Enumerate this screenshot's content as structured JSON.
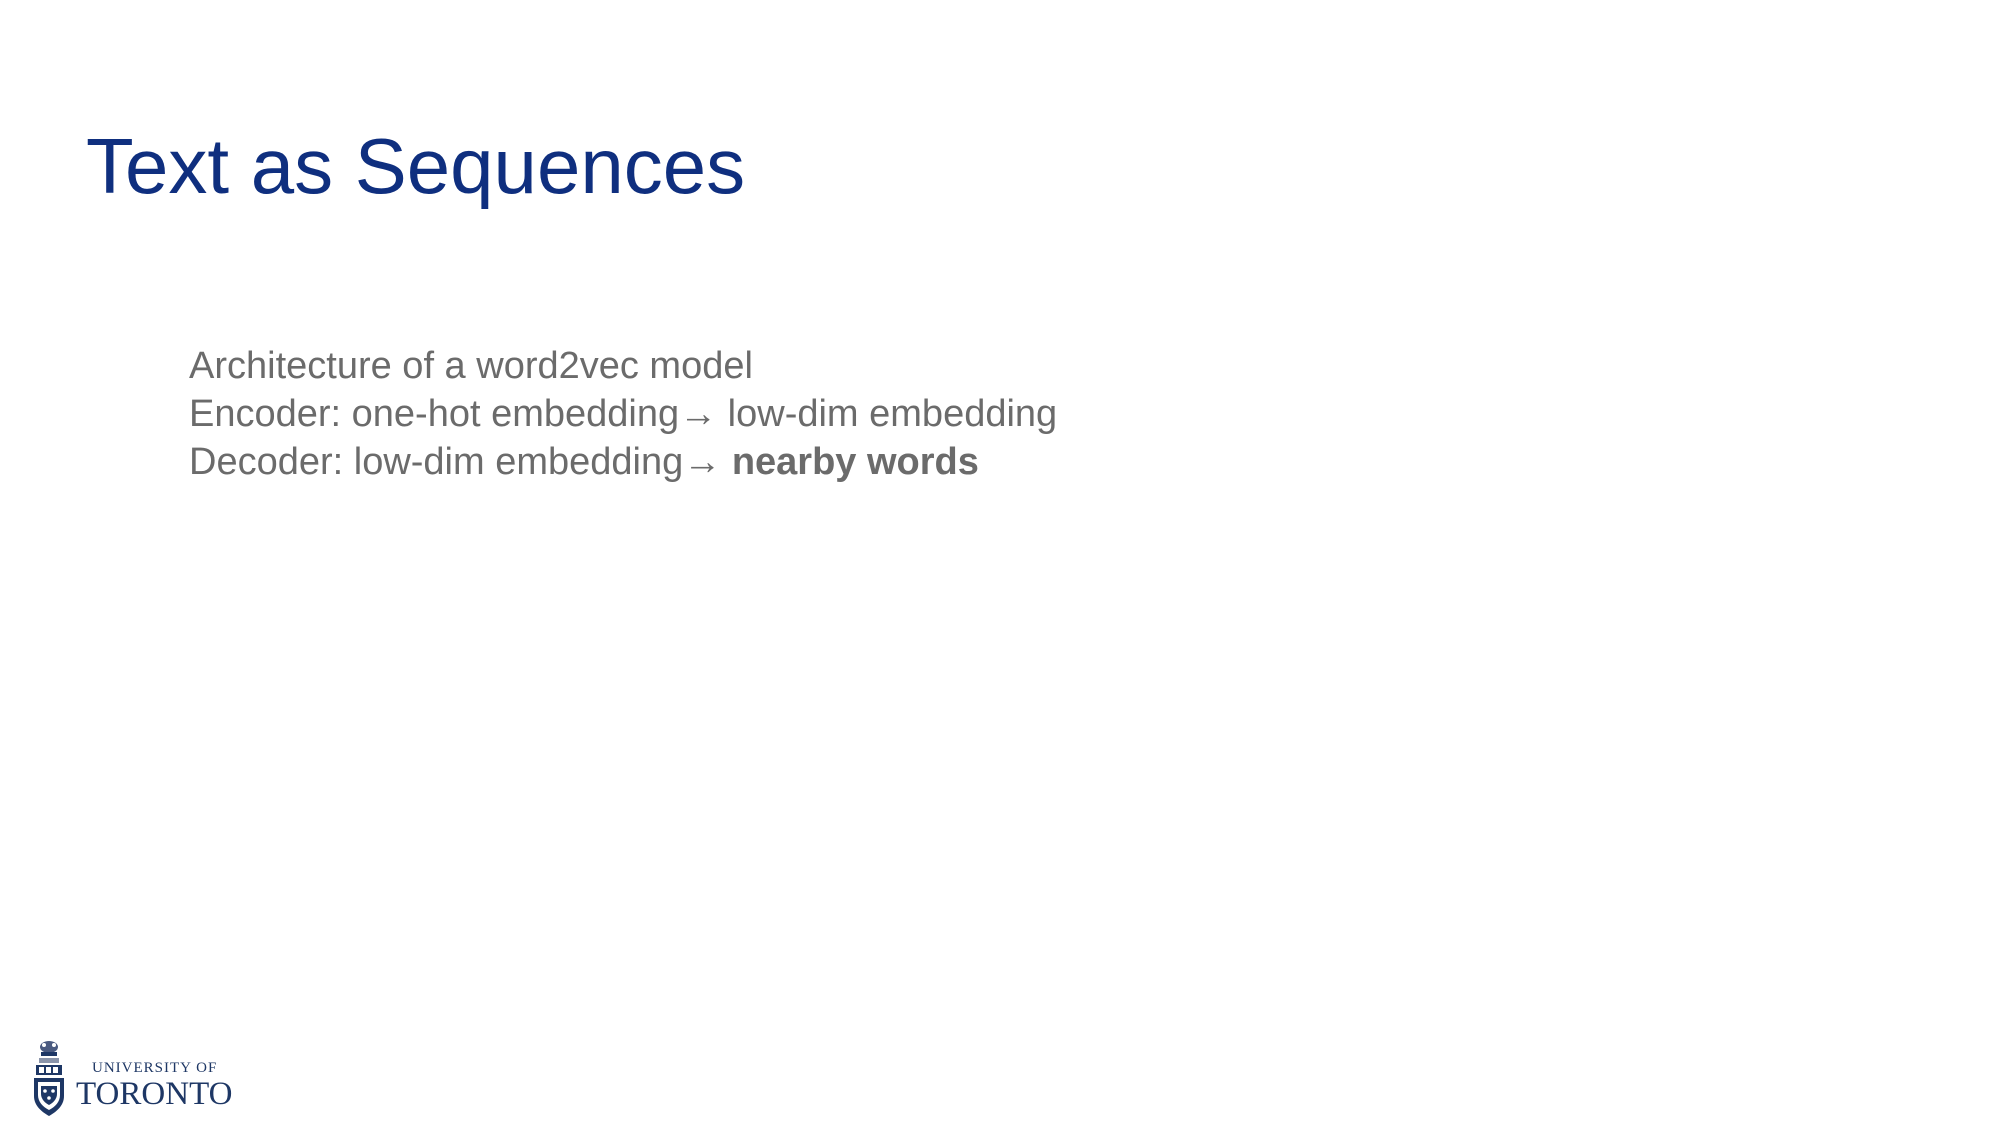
{
  "slide": {
    "title": "Text as Sequences",
    "lines": [
      {
        "text": "Architecture of a word2vec model"
      },
      {
        "text": "Encoder: one-hot embedding→ low-dim embedding"
      },
      {
        "text": "Decoder: low-dim embedding→ ",
        "strong": "nearby words"
      }
    ]
  },
  "logo": {
    "line1": "UNIVERSITY OF",
    "line2": "TORONTO"
  },
  "colors": {
    "title": "#0f2f7f",
    "body": "#6b6b6b",
    "logo": "#1e3765"
  }
}
